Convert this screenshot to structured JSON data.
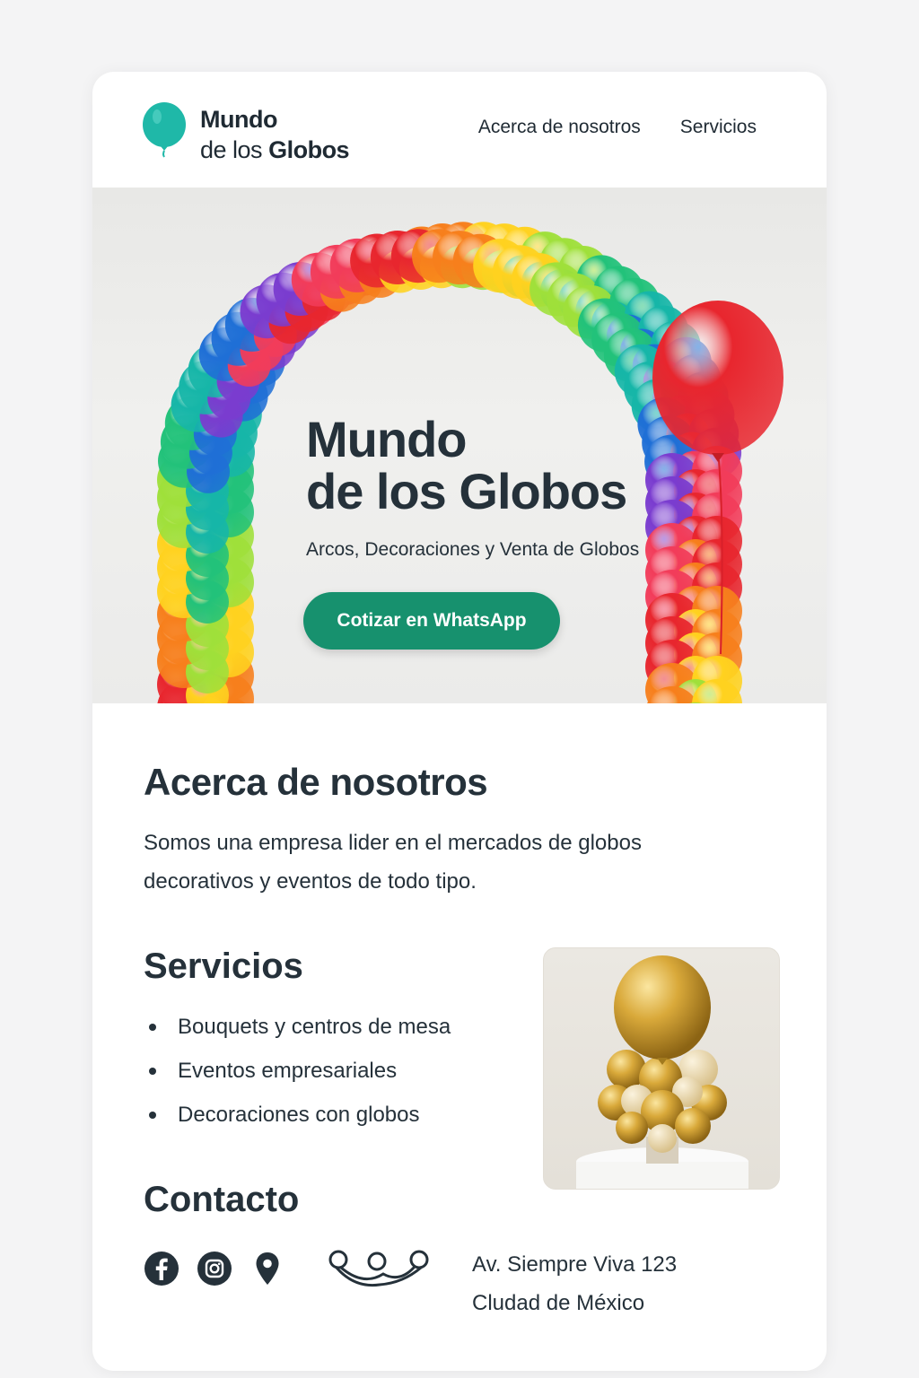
{
  "brand": {
    "name_line1": "Mundo",
    "name_line2a": "de los",
    "name_line2b": "Globos",
    "accent": "#1fb8a8",
    "icon": "balloon-icon"
  },
  "nav": {
    "items": [
      "Acerca de nosotros",
      "Servicios"
    ]
  },
  "hero": {
    "title_line1": "Mundo",
    "title_line2": "de los Globos",
    "subtitle": "Arcos, Decoraciones y Venta de Globos",
    "cta_label": "Cotizar en WhatsApp",
    "cta_color": "#17916e"
  },
  "about": {
    "title": "Acerca de nosotros",
    "text": "Somos una empresa lider en el mercados de globos decorativos y eventos de todo tipo."
  },
  "services": {
    "title": "Servicios",
    "items": [
      "Bouquets y centros de mesa",
      "Eventos empresariales",
      "Decoraciones con globos"
    ]
  },
  "contact": {
    "title": "Contacto",
    "icons": [
      "facebook-icon",
      "instagram-icon",
      "location-pin-icon"
    ],
    "address_line1": "Av. Siempre Viva 123",
    "address_line2": "Cludad de México"
  }
}
